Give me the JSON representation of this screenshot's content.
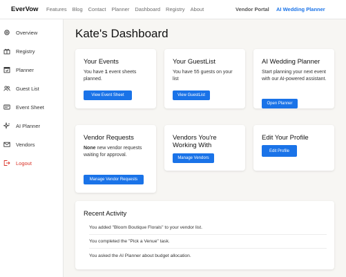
{
  "topnav": {
    "brand": "EverVow",
    "links": [
      "Features",
      "Blog",
      "Contact",
      "Planner",
      "Dashboard",
      "Registry",
      "About"
    ],
    "vendor_portal": "Vendor Portal",
    "ai_wedding_planner": "AI Wedding Planner"
  },
  "sidebar": {
    "items": [
      {
        "label": "Overview",
        "icon": "gear-icon"
      },
      {
        "label": "Registry",
        "icon": "gift-icon"
      },
      {
        "label": "Planner",
        "icon": "calendar-icon"
      },
      {
        "label": "Guest List",
        "icon": "people-icon"
      },
      {
        "label": "Event Sheet",
        "icon": "card-icon"
      },
      {
        "label": "AI Planner",
        "icon": "sparkle-icon"
      },
      {
        "label": "Vendors",
        "icon": "envelope-icon"
      },
      {
        "label": "Logout",
        "icon": "logout-icon"
      }
    ]
  },
  "page": {
    "title": "Kate's Dashboard"
  },
  "cards": {
    "events": {
      "title": "Your Events",
      "text_prefix": "You have ",
      "count": "1",
      "text_suffix": " event sheets planned.",
      "button": "View Event Sheet"
    },
    "guestlist": {
      "title": "Your GuestList",
      "text": "You have 55 guests on your list",
      "button": "View GuestList"
    },
    "ai_planner": {
      "title": "AI Wedding Planner",
      "text": "Start planning your next event with our AI-powered assistant.",
      "button": "Open Planner"
    },
    "vendor_requests": {
      "title": "Vendor Requests",
      "text_strong": "None",
      "text_rest": " new vendor requests waiting for approval.",
      "button": "Manage Vendor Requests"
    },
    "vendors_working": {
      "title": "Vendors You're Working With",
      "button": "Manage Vendors"
    },
    "edit_profile": {
      "title": "Edit Your Profile",
      "button": "Edit Profile"
    }
  },
  "recent_activity": {
    "title": "Recent Activity",
    "items": [
      "You added \"Bloom Boutique Florals\" to your vendor list.",
      "You completed the \"Pick a Venue\" task.",
      "You asked the AI Planner about budget allocation."
    ]
  },
  "colors": {
    "accent": "#1a73e8",
    "logout": "#d93025",
    "background": "#f7f6f3"
  }
}
